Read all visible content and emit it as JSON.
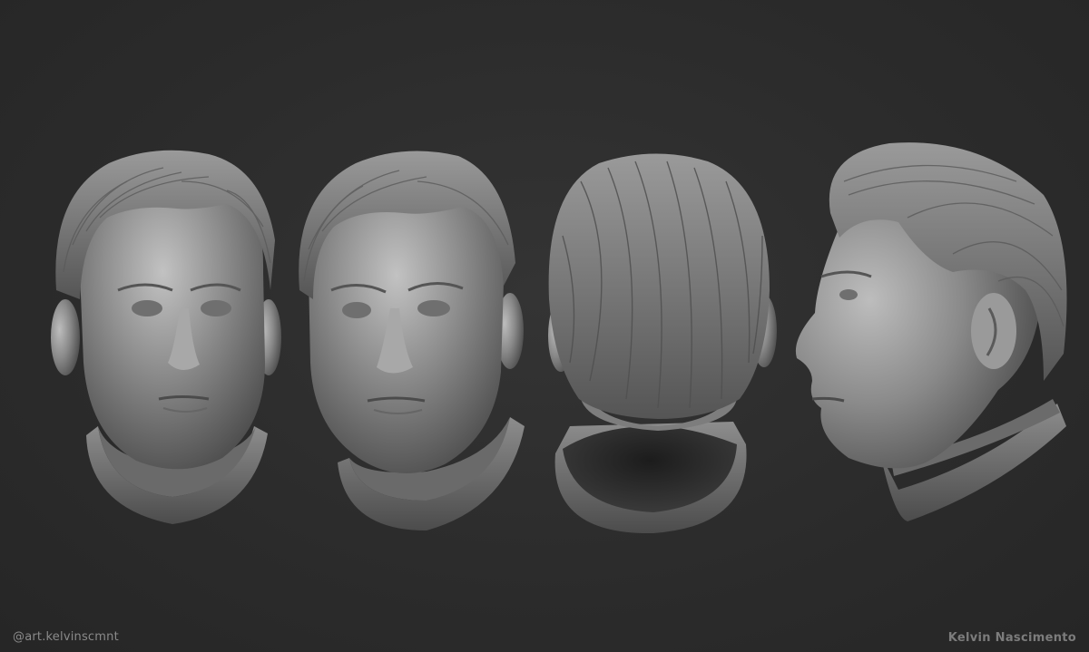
{
  "credits": {
    "handle": "@art.kelvinscmnt",
    "signature": "Kelvin Nascimento"
  },
  "colors": {
    "background": "#2c2c2c",
    "clay": "#8e8e8e",
    "clay_highlight": "#c4c4c4",
    "clay_shadow": "#4a4a4a"
  },
  "views": [
    {
      "name": "front"
    },
    {
      "name": "three-quarter"
    },
    {
      "name": "back"
    },
    {
      "name": "profile"
    }
  ]
}
